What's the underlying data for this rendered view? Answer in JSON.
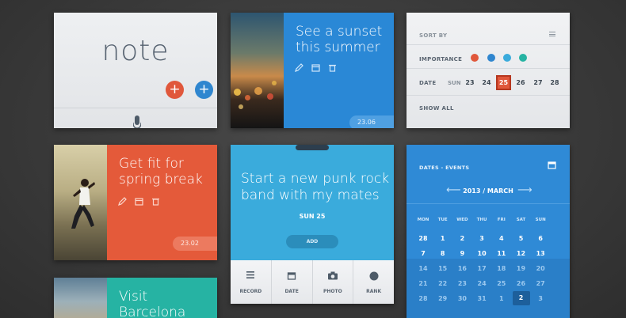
{
  "note_card": {
    "title": "note",
    "add_red_label": "+",
    "add_blue_label": "+",
    "mic_icon": "microphone-icon"
  },
  "sunset_card": {
    "title": "See a sunset this summer",
    "date": "23.06",
    "icons": [
      "pencil-icon",
      "calendar-icon",
      "trash-icon"
    ]
  },
  "sort_card": {
    "sort_by": "SORT BY",
    "importance": "IMPORTANCE",
    "importance_colors": [
      "#e0573b",
      "#2f86cf",
      "#3aabdc",
      "#26b3a3"
    ],
    "date_label": "DATE",
    "day_name": "SUN",
    "days": [
      "23",
      "24",
      "25",
      "26",
      "27",
      "28"
    ],
    "selected_day": "25",
    "show_all": "SHOW ALL"
  },
  "fit_card": {
    "title": "Get fit for spring break",
    "date": "23.02"
  },
  "punk_card": {
    "title": "Start a new punk rock band with my mates",
    "date_text": "SUN  25",
    "add_label": "ADD",
    "tools": [
      {
        "label": "RECORD",
        "icon": "menu-icon"
      },
      {
        "label": "DATE",
        "icon": "calendar-icon"
      },
      {
        "label": "PHOTO",
        "icon": "camera-icon"
      },
      {
        "label": "RANK",
        "icon": "circle-icon"
      }
    ]
  },
  "barcelona_card": {
    "title": "Visit Barcelona"
  },
  "calendar_card": {
    "label": "DATES - EVENTS",
    "month": "2013 / MARCH",
    "weekdays": [
      "MON",
      "TUE",
      "WED",
      "THU",
      "FRI",
      "SAT",
      "SUN"
    ],
    "rows": [
      [
        "28",
        "1",
        "2",
        "3",
        "4",
        "5",
        "6"
      ],
      [
        "7",
        "8",
        "9",
        "10",
        "11",
        "12",
        "13"
      ],
      [
        "14",
        "15",
        "16",
        "17",
        "18",
        "19",
        "20"
      ],
      [
        "21",
        "22",
        "23",
        "24",
        "25",
        "26",
        "27"
      ],
      [
        "28",
        "29",
        "30",
        "31",
        "1",
        "2",
        "3"
      ]
    ],
    "selected": "2"
  }
}
